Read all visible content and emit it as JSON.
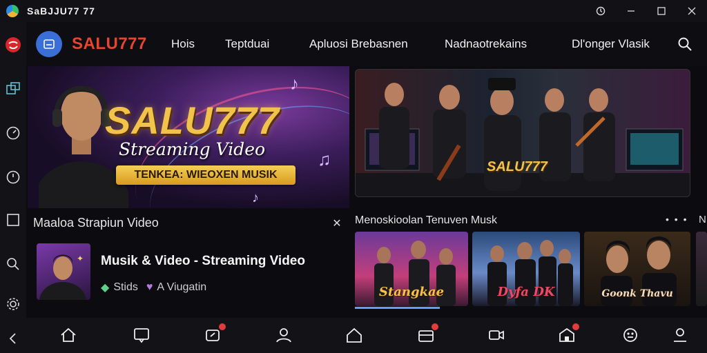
{
  "window": {
    "title": "SaBJJU77 77",
    "controls": [
      "history-icon",
      "minimize-icon",
      "maximize-icon",
      "close-icon"
    ]
  },
  "rail": {
    "icons": [
      "brand-icon",
      "folders-icon",
      "gauge-icon",
      "clock-icon",
      "square-icon",
      "search-icon",
      "settings-icon",
      "back-icon"
    ]
  },
  "header": {
    "brand": "SALU777",
    "nav": [
      "Hois",
      "Teptduai",
      "Apluosi Brebasnen",
      "Nadnaotrekains",
      "Dl'onger Vlasik"
    ]
  },
  "hero": {
    "title": "SALU777",
    "subtitle": "Streaming Video",
    "banner": "TENKEA: WIEOXEN MUSIK"
  },
  "video_panel": {
    "overlay_text": "SALU777"
  },
  "left_section": {
    "title": "Maaloa Strapiun Video",
    "item": {
      "title": "Musik & Video - Streaming Video",
      "meta_a": "Stids",
      "meta_b": "A Viugatin"
    }
  },
  "right_section": {
    "title": "Menoskioolan Tenuven Musk",
    "more": "• • •",
    "edge": "N",
    "thumbs": [
      {
        "label": "Stangkae",
        "accent": "#c23fa8"
      },
      {
        "label": "Dyfa DK",
        "accent": "#2b6fd0"
      },
      {
        "label": "Goonk Thavu",
        "accent": "#8a6a3a"
      }
    ],
    "first_thumb_progress": 1.0
  },
  "bottom_nav": {
    "icons": [
      "home-icon",
      "chat-icon",
      "share-icon",
      "profile-icon",
      "house-icon",
      "inbox-icon",
      "video-call-icon",
      "store-icon",
      "gamepad-icon",
      "account-icon"
    ],
    "badges": [
      false,
      false,
      true,
      false,
      false,
      true,
      false,
      true,
      false,
      false
    ]
  },
  "colors": {
    "brand_red": "#e8452c",
    "gold": "#f1c34a",
    "badge_red": "#e23b3b",
    "accent_blue": "#3a6fd8"
  }
}
